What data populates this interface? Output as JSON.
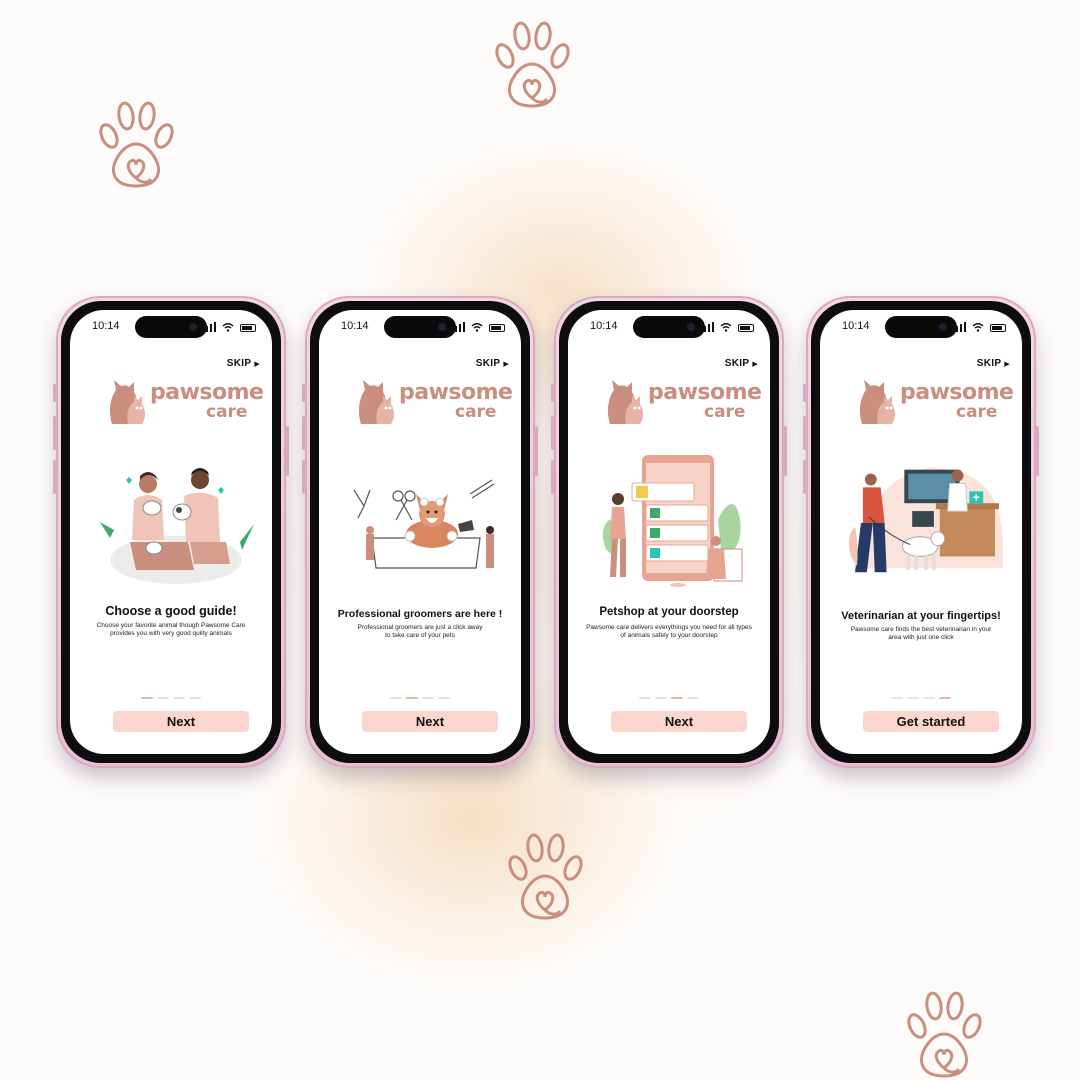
{
  "colors": {
    "accent": "#c98e7e",
    "button": "#fcd6cc",
    "frame": "#e8bfd2",
    "dot_active": "#e3b6a8"
  },
  "screens": [
    {
      "time": "10:14",
      "skip": "SKIP",
      "logo_line1": "pawsome",
      "logo_line2": "care",
      "title": "Choose a good guide!",
      "description": "Choose your favorite animal though Pawsome Care provides you with very good quilty animals",
      "active_dot": 1,
      "button": "Next"
    },
    {
      "time": "10:14",
      "skip": "SKIP",
      "logo_line1": "pawsome",
      "logo_line2": "care",
      "title": "Professional groomers are here !",
      "description": "Professional groomers are just a click away to take care of your pets",
      "active_dot": 2,
      "button": "Next"
    },
    {
      "time": "10:14",
      "skip": "SKIP",
      "logo_line1": "pawsome",
      "logo_line2": "care",
      "title": "Petshop at your doorstep",
      "description": "Pawsome care delivers everythings you need for all types of animals safely to your doorstep",
      "active_dot": 3,
      "button": "Next"
    },
    {
      "time": "10:14",
      "skip": "SKIP",
      "logo_line1": "pawsome",
      "logo_line2": "care",
      "title": "Veterinarian at your fingertips!",
      "description": "Pawsome care finds the best veterinarian in your area with just one click",
      "active_dot": 4,
      "button": "Get started"
    }
  ],
  "icons": [
    "paw-heart-icon",
    "signal-icon",
    "wifi-icon",
    "battery-icon",
    "play-arrow-icon",
    "dog-cat-logo-icon"
  ]
}
